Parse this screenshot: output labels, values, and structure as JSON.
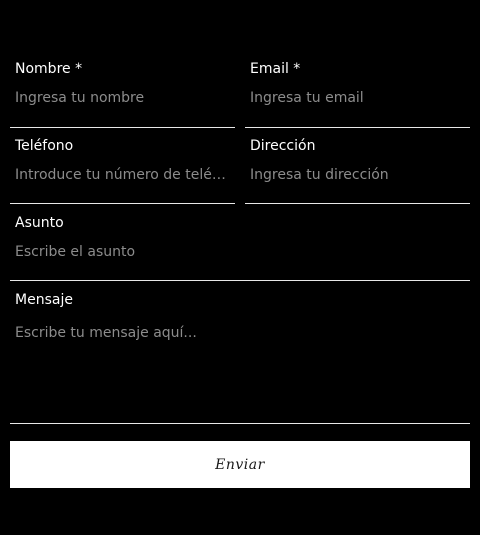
{
  "form": {
    "fields": {
      "nombre": {
        "label": "Nombre *",
        "placeholder": "Ingresa tu nombre"
      },
      "email": {
        "label": "Email *",
        "placeholder": "Ingresa tu email"
      },
      "telefono": {
        "label": "Teléfono",
        "placeholder": "Introduce tu número de teléfono"
      },
      "direccion": {
        "label": "Dirección",
        "placeholder": "Ingresa tu dirección"
      },
      "asunto": {
        "label": "Asunto",
        "placeholder": "Escribe el asunto"
      },
      "mensaje": {
        "label": "Mensaje",
        "placeholder": "Escribe tu mensaje aquí..."
      }
    },
    "submit_label": "Enviar"
  },
  "colors": {
    "background": "#000000",
    "text": "#ffffff",
    "placeholder": "#8c8c8c",
    "underline": "#e8e8e8",
    "button_bg": "#ffffff",
    "button_text": "#1a1a1a"
  }
}
